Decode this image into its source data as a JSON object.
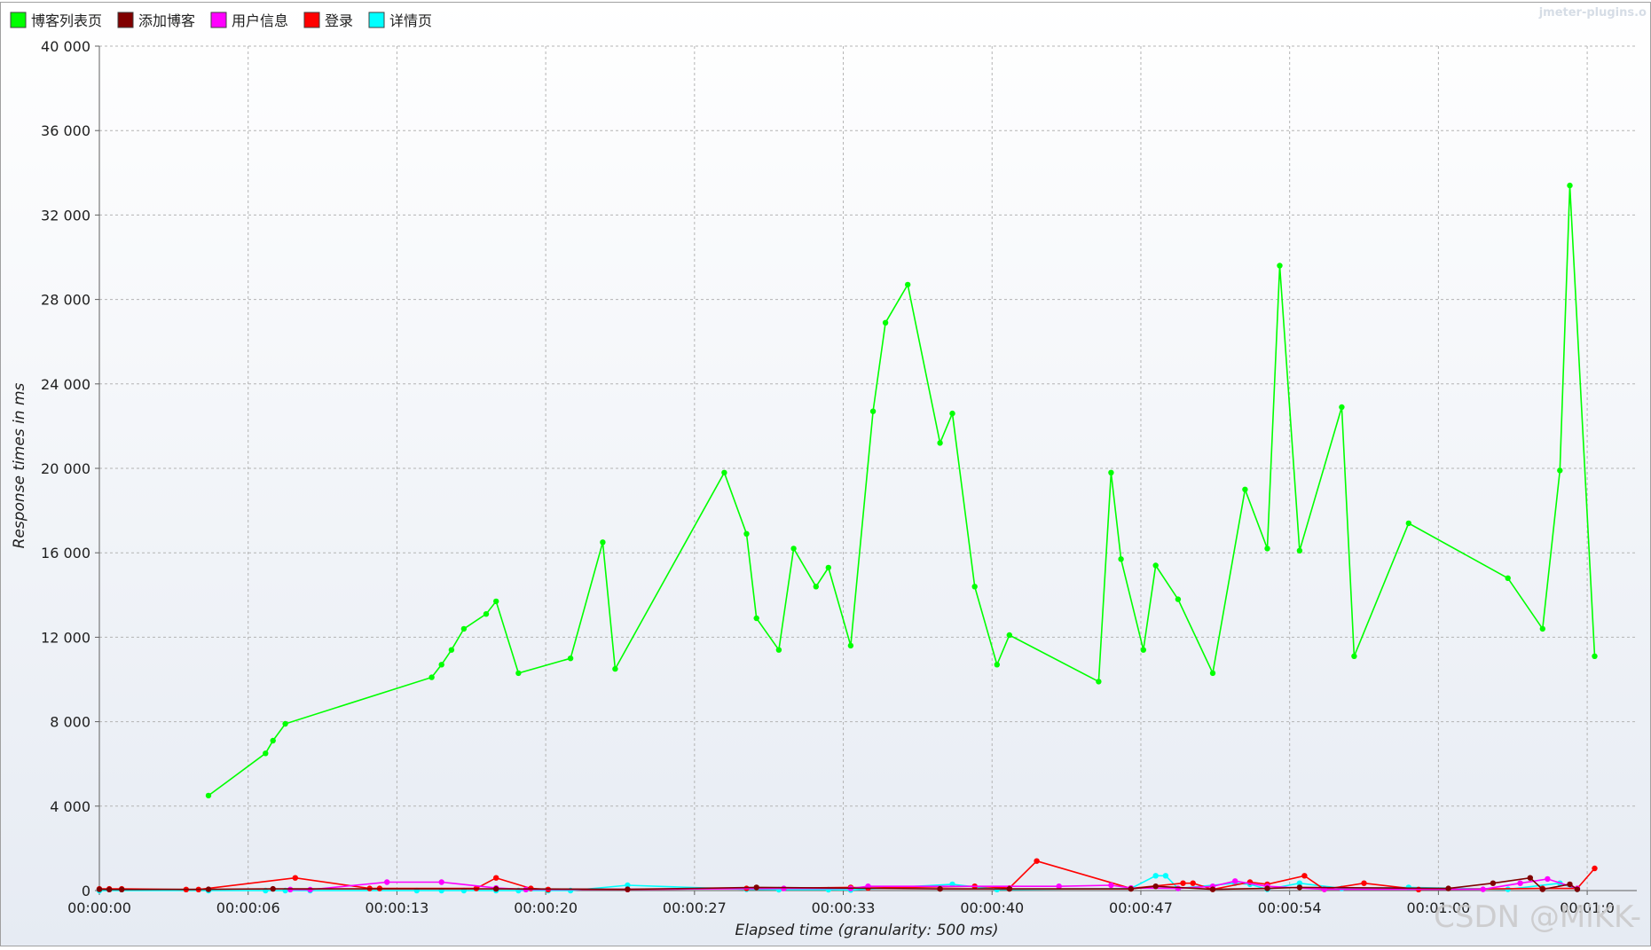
{
  "watermarks": {
    "top_right": "jmeter-plugins.o",
    "bottom_right": "CSDN @MiKK-"
  },
  "chart_data": {
    "type": "line",
    "title": "",
    "xlabel": "Elapsed time (granularity: 500 ms)",
    "ylabel": "Response times in ms",
    "x_unit": "seconds elapsed",
    "xlim": [
      0,
      62
    ],
    "ylim": [
      0,
      40000
    ],
    "y_ticks": [
      {
        "value": 0,
        "label": "0"
      },
      {
        "value": 4000,
        "label": "4 000"
      },
      {
        "value": 8000,
        "label": "8 000"
      },
      {
        "value": 12000,
        "label": "12 000"
      },
      {
        "value": 16000,
        "label": "16 000"
      },
      {
        "value": 20000,
        "label": "20 000"
      },
      {
        "value": 24000,
        "label": "24 000"
      },
      {
        "value": 28000,
        "label": "28 000"
      },
      {
        "value": 32000,
        "label": "32 000"
      },
      {
        "value": 36000,
        "label": "36 000"
      },
      {
        "value": 40000,
        "label": "40 000"
      }
    ],
    "x_ticks": [
      {
        "value": 0,
        "label": "00:00:00"
      },
      {
        "value": 6,
        "label": "00:00:06"
      },
      {
        "value": 12,
        "label": "00:00:13"
      },
      {
        "value": 18,
        "label": "00:00:20"
      },
      {
        "value": 24,
        "label": "00:00:27"
      },
      {
        "value": 30,
        "label": "00:00:33"
      },
      {
        "value": 36,
        "label": "00:00:40"
      },
      {
        "value": 42,
        "label": "00:00:47"
      },
      {
        "value": 48,
        "label": "00:00:54"
      },
      {
        "value": 54,
        "label": "00:01:00"
      },
      {
        "value": 60,
        "label": "00:01:0"
      }
    ],
    "grid": true,
    "legend_position": "top-left",
    "series": [
      {
        "name": "博客列表页",
        "color": "#00ff00",
        "points": [
          [
            4.4,
            4500
          ],
          [
            6.7,
            6500
          ],
          [
            7.0,
            7100
          ],
          [
            7.5,
            7900
          ],
          [
            13.4,
            10100
          ],
          [
            13.8,
            10700
          ],
          [
            14.2,
            11400
          ],
          [
            14.7,
            12400
          ],
          [
            15.6,
            13100
          ],
          [
            16.0,
            13700
          ],
          [
            16.9,
            10300
          ],
          [
            19.0,
            11000
          ],
          [
            20.3,
            16500
          ],
          [
            20.8,
            10500
          ],
          [
            25.2,
            19800
          ],
          [
            26.1,
            16900
          ],
          [
            26.5,
            12900
          ],
          [
            27.4,
            11400
          ],
          [
            28.0,
            16200
          ],
          [
            28.9,
            14400
          ],
          [
            29.4,
            15300
          ],
          [
            30.3,
            11600
          ],
          [
            31.2,
            22700
          ],
          [
            31.7,
            26900
          ],
          [
            32.6,
            28700
          ],
          [
            33.9,
            21200
          ],
          [
            34.4,
            22600
          ],
          [
            35.3,
            14400
          ],
          [
            36.2,
            10700
          ],
          [
            36.7,
            12100
          ],
          [
            40.3,
            9900
          ],
          [
            40.8,
            19800
          ],
          [
            41.2,
            15700
          ],
          [
            42.1,
            11400
          ],
          [
            42.6,
            15400
          ],
          [
            43.5,
            13800
          ],
          [
            44.9,
            10300
          ],
          [
            46.2,
            19000
          ],
          [
            47.1,
            16200
          ],
          [
            47.6,
            29600
          ],
          [
            48.4,
            16100
          ],
          [
            50.1,
            22900
          ],
          [
            50.6,
            11100
          ],
          [
            52.8,
            17400
          ],
          [
            56.8,
            14800
          ],
          [
            58.2,
            12400
          ],
          [
            58.9,
            19900
          ],
          [
            59.3,
            33400
          ],
          [
            60.3,
            11100
          ]
        ]
      },
      {
        "name": "添加博客",
        "color": "#800000",
        "points": [
          [
            0,
            60
          ],
          [
            0.4,
            50
          ],
          [
            0.9,
            50
          ],
          [
            4.4,
            60
          ],
          [
            7.0,
            80
          ],
          [
            16.0,
            80
          ],
          [
            21.3,
            60
          ],
          [
            26.5,
            150
          ],
          [
            33.9,
            80
          ],
          [
            36.7,
            80
          ],
          [
            41.6,
            80
          ],
          [
            42.6,
            200
          ],
          [
            44.9,
            60
          ],
          [
            47.1,
            100
          ],
          [
            48.4,
            150
          ],
          [
            54.4,
            100
          ],
          [
            56.2,
            350
          ],
          [
            57.7,
            600
          ],
          [
            58.2,
            60
          ],
          [
            59.3,
            300
          ],
          [
            59.6,
            60
          ]
        ]
      },
      {
        "name": "用户信息",
        "color": "#ff00ff",
        "points": [
          [
            7.7,
            50
          ],
          [
            8.5,
            40
          ],
          [
            11.6,
            400
          ],
          [
            13.8,
            400
          ],
          [
            16.0,
            120
          ],
          [
            17.2,
            50
          ],
          [
            21.3,
            60
          ],
          [
            27.6,
            100
          ],
          [
            30.3,
            100
          ],
          [
            31.0,
            200
          ],
          [
            38.7,
            200
          ],
          [
            40.8,
            250
          ],
          [
            41.6,
            120
          ],
          [
            43.5,
            100
          ],
          [
            44.9,
            200
          ],
          [
            45.8,
            450
          ],
          [
            47.1,
            200
          ],
          [
            49.4,
            60
          ],
          [
            55.8,
            60
          ],
          [
            57.3,
            350
          ],
          [
            58.4,
            550
          ],
          [
            59.6,
            100
          ]
        ]
      },
      {
        "name": "登录",
        "color": "#ff0000",
        "points": [
          [
            0,
            80
          ],
          [
            0.4,
            80
          ],
          [
            0.9,
            80
          ],
          [
            3.5,
            50
          ],
          [
            4.0,
            50
          ],
          [
            7.9,
            600
          ],
          [
            10.9,
            100
          ],
          [
            11.3,
            100
          ],
          [
            15.2,
            100
          ],
          [
            16.0,
            600
          ],
          [
            17.4,
            100
          ],
          [
            18.1,
            50
          ],
          [
            21.3,
            50
          ],
          [
            26.1,
            100
          ],
          [
            30.3,
            150
          ],
          [
            31.0,
            120
          ],
          [
            35.3,
            200
          ],
          [
            36.7,
            120
          ],
          [
            37.8,
            1400
          ],
          [
            41.6,
            100
          ],
          [
            43.7,
            350
          ],
          [
            44.1,
            350
          ],
          [
            44.9,
            60
          ],
          [
            46.4,
            400
          ],
          [
            47.1,
            300
          ],
          [
            48.6,
            700
          ],
          [
            49.4,
            60
          ],
          [
            51.0,
            350
          ],
          [
            53.2,
            50
          ],
          [
            58.2,
            100
          ],
          [
            59.6,
            100
          ],
          [
            60.3,
            1050
          ]
        ]
      },
      {
        "name": "详情页",
        "color": "#00ffff",
        "points": [
          [
            0,
            0
          ],
          [
            4.4,
            0
          ],
          [
            6.7,
            0
          ],
          [
            7.5,
            0
          ],
          [
            8.5,
            0
          ],
          [
            12.8,
            0
          ],
          [
            13.8,
            0
          ],
          [
            14.7,
            0
          ],
          [
            16.0,
            0
          ],
          [
            16.9,
            0
          ],
          [
            18.1,
            0
          ],
          [
            19.0,
            0
          ],
          [
            21.3,
            250
          ],
          [
            26.1,
            60
          ],
          [
            27.4,
            40
          ],
          [
            29.4,
            40
          ],
          [
            30.3,
            30
          ],
          [
            34.4,
            300
          ],
          [
            36.2,
            50
          ],
          [
            41.6,
            100
          ],
          [
            42.6,
            700
          ],
          [
            43.0,
            700
          ],
          [
            43.5,
            100
          ],
          [
            45.8,
            350
          ],
          [
            46.4,
            300
          ],
          [
            47.1,
            60
          ],
          [
            48.4,
            350
          ],
          [
            50.1,
            100
          ],
          [
            52.8,
            150
          ],
          [
            56.8,
            60
          ],
          [
            58.9,
            350
          ],
          [
            59.6,
            60
          ]
        ]
      }
    ]
  }
}
